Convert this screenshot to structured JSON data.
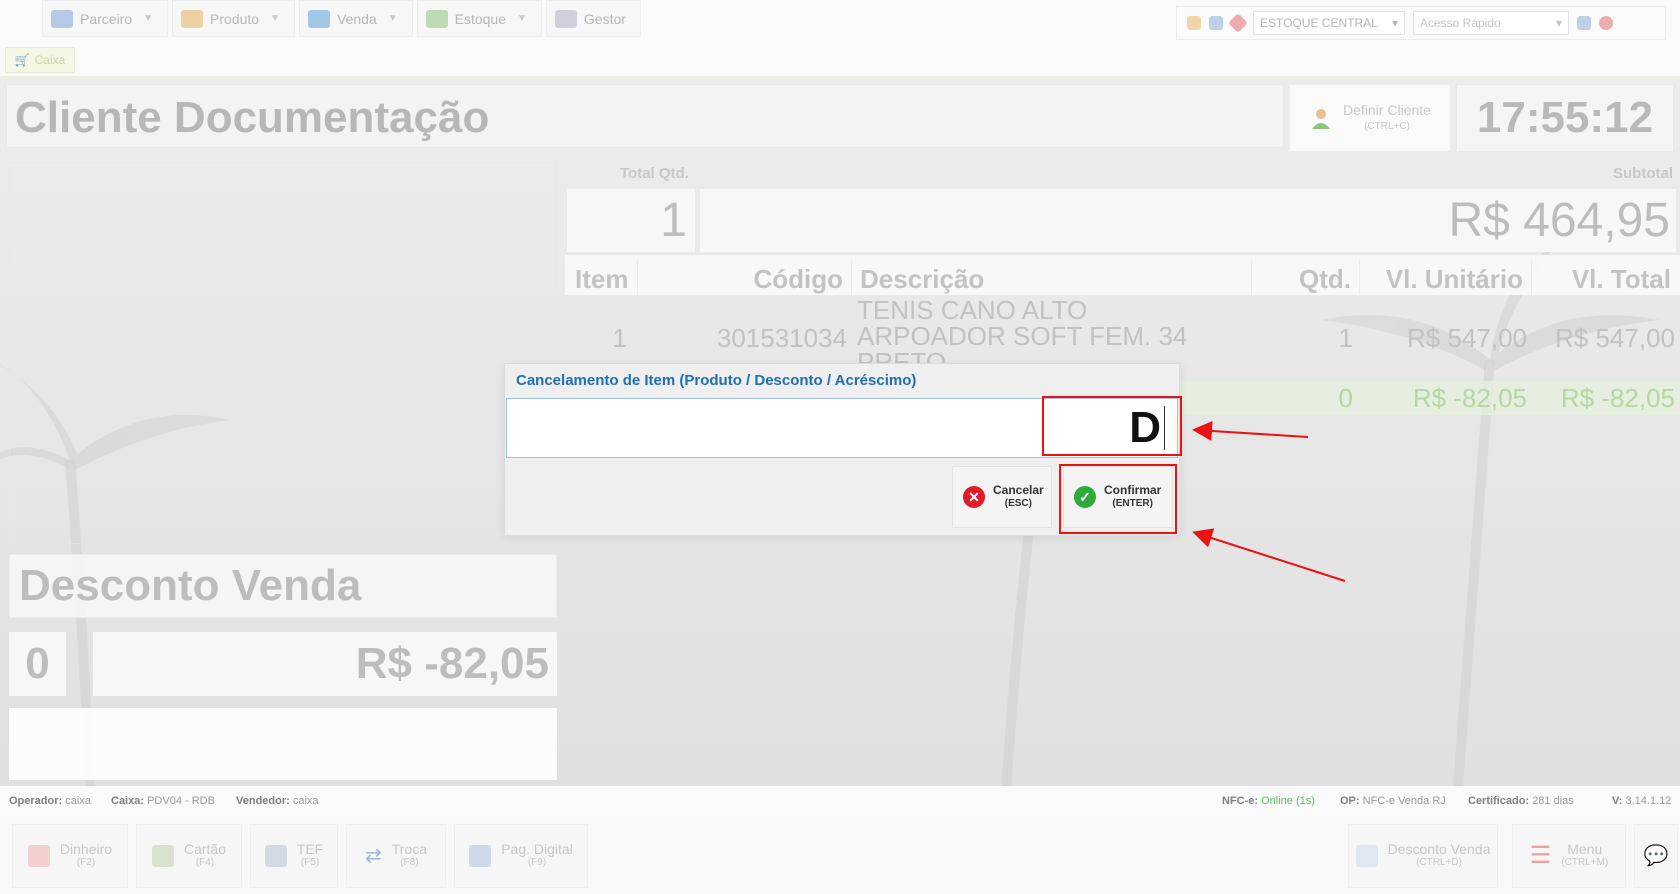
{
  "menu": [
    {
      "label": "Parceiro",
      "icon": "people-icon",
      "has_dropdown": true
    },
    {
      "label": "Produto",
      "icon": "box-icon",
      "has_dropdown": true
    },
    {
      "label": "Venda",
      "icon": "cart-icon",
      "has_dropdown": true
    },
    {
      "label": "Estoque",
      "icon": "stock-icon",
      "has_dropdown": true
    },
    {
      "label": "Gestor",
      "icon": "chart-icon",
      "has_dropdown": false
    }
  ],
  "toolbox": {
    "warehouse": "ESTOQUE CENTRAL",
    "quick_access_placeholder": "Acesso Rápido"
  },
  "tab": {
    "label": "Caixa"
  },
  "client": {
    "name": "Cliente Documentação"
  },
  "define_client": {
    "label": "Definir Cliente",
    "shortcut": "(CTRL+C)"
  },
  "clock": "17:55:12",
  "discount_panel": {
    "title": "Desconto Venda",
    "qty": "0",
    "value": "R$ -82,05"
  },
  "totals": {
    "qty_label": "Total Qtd.",
    "subtotal_label": "Subtotal",
    "qty": "1",
    "subtotal": "R$ 464,95"
  },
  "table": {
    "headers": [
      "Item",
      "Código",
      "Descrição",
      "Qtd.",
      "Vl. Unitário",
      "Vl. Total"
    ],
    "rows": [
      {
        "item": "1",
        "code": "301531034",
        "desc": [
          "TENIS CANO ALTO",
          "ARPOADOR SOFT FEM. 34",
          "PRETO"
        ],
        "qty": "1",
        "unit": "R$ 547,00",
        "total": "R$ 547,00"
      },
      {
        "item": "",
        "code": "",
        "desc": [
          ""
        ],
        "qty": "0",
        "unit": "R$ -82,05",
        "total": "R$ -82,05"
      }
    ]
  },
  "dialog": {
    "title": "Cancelamento de Item (Produto / Desconto / Acréscimo)",
    "input_value": "D",
    "cancel": {
      "label": "Cancelar",
      "shortcut": "(ESC)"
    },
    "confirm": {
      "label": "Confirmar",
      "shortcut": "(ENTER)"
    }
  },
  "status": {
    "operator_label": "Operador:",
    "operator": "caixa",
    "cashier_label": "Caixa:",
    "cashier": "PDV04 - RDB",
    "seller_label": "Vendedor:",
    "seller": "caixa",
    "nfce_label": "NFC-e:",
    "nfce": "Online (1s)",
    "op_label": "OP:",
    "op": "NFC-e Venda RJ",
    "cert_label": "Certificado:",
    "cert": "281 dias",
    "version_label": "V:",
    "version": "3.14.1.12"
  },
  "footer_buttons": [
    {
      "label": "Dinheiro",
      "shortcut": "(F2)"
    },
    {
      "label": "Cartão",
      "shortcut": "(F4)"
    },
    {
      "label": "TEF",
      "shortcut": "(F5)"
    },
    {
      "label": "Troca",
      "shortcut": "(F8)"
    },
    {
      "label": "Pag. Digital",
      "shortcut": "(F9)"
    },
    {
      "label": "Desconto Venda",
      "shortcut": "(CTRL+D)"
    },
    {
      "label": "Menu",
      "shortcut": "(CTRL+M)"
    }
  ],
  "colors": {
    "accent": "#1f6fb5",
    "highlight": "#e11111",
    "confirm_green": "#2eaa3b",
    "cancel_red": "#e01c2a"
  }
}
